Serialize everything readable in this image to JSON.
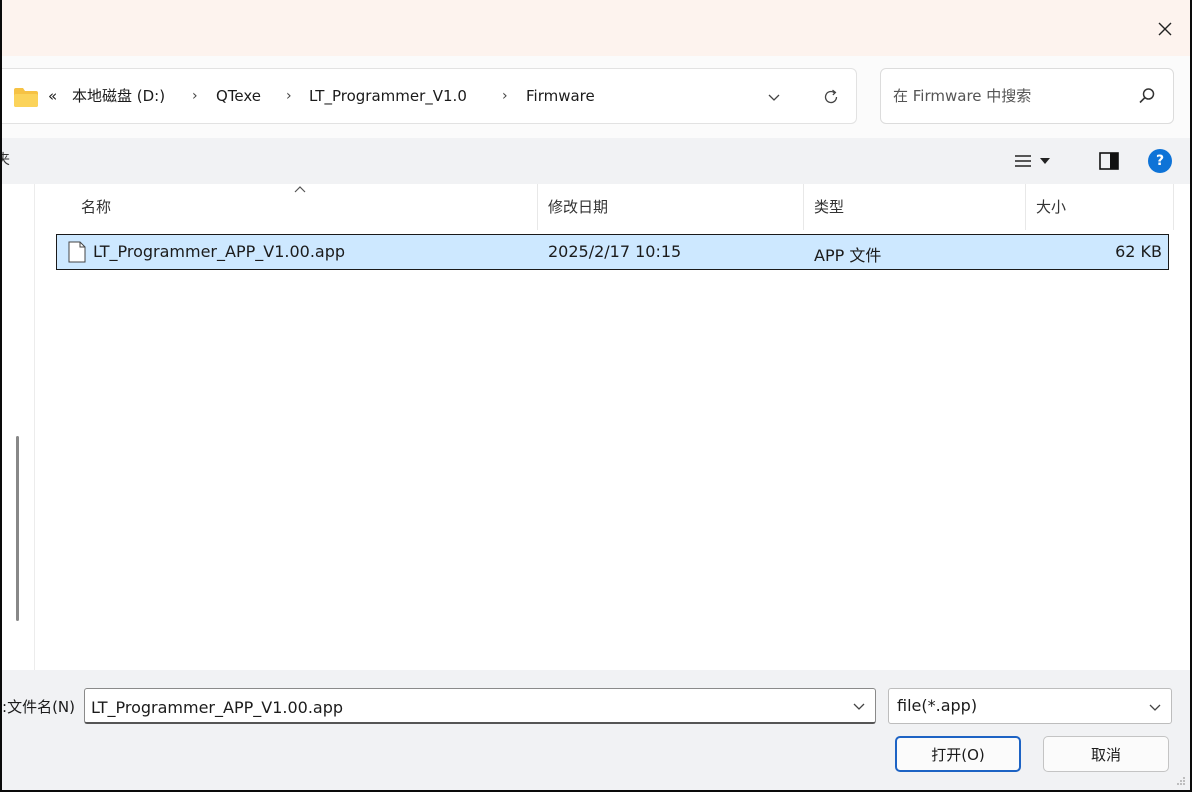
{
  "titlebar": {
    "close_glyph": "✕"
  },
  "address": {
    "folder_icon": "folder-icon",
    "overflow": "«",
    "crumbs": [
      "本地磁盘 (D:)",
      "QTexe",
      "LT_Programmer_V1.0",
      "Firmware"
    ],
    "separator": "›"
  },
  "search": {
    "placeholder": "在 Firmware 中搜索"
  },
  "toolbar": {
    "truncated_label": "夹"
  },
  "columns": {
    "name": "名称",
    "modified": "修改日期",
    "type": "类型",
    "size": "大小"
  },
  "files": [
    {
      "name": "LT_Programmer_APP_V1.00.app",
      "modified": "2025/2/17 10:15",
      "type": "APP 文件",
      "size": "62 KB"
    }
  ],
  "bottom": {
    "filename_label": "文件名(N):",
    "filename_value": "LT_Programmer_APP_V1.00.app",
    "filter_value": "file(*.app)",
    "open_label": "打开(O)",
    "cancel_label": "取消"
  },
  "colors": {
    "selection": "#cde8ff",
    "accent": "#0e73d7",
    "titlebar": "#fdf3ee",
    "folder": "#f6c244"
  }
}
